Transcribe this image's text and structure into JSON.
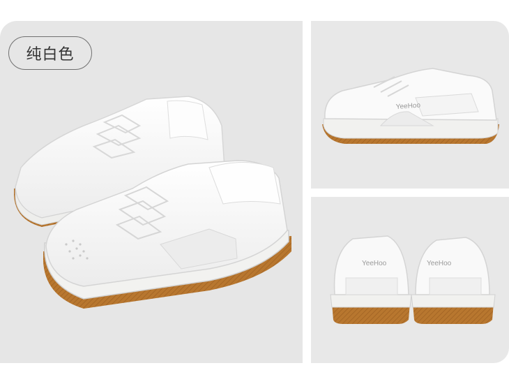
{
  "color_chip": {
    "label": "纯白色"
  },
  "brand_text": {
    "side_view": "YeeHoo",
    "back_left": "YeeHoo",
    "back_right": "YeeHoo"
  },
  "colors": {
    "panel_bg": "#e6e6e6",
    "upper": "#f8f8f8",
    "sole": "#ededeb",
    "outsole": "#b8772f",
    "logo": "#9a9a9a"
  }
}
